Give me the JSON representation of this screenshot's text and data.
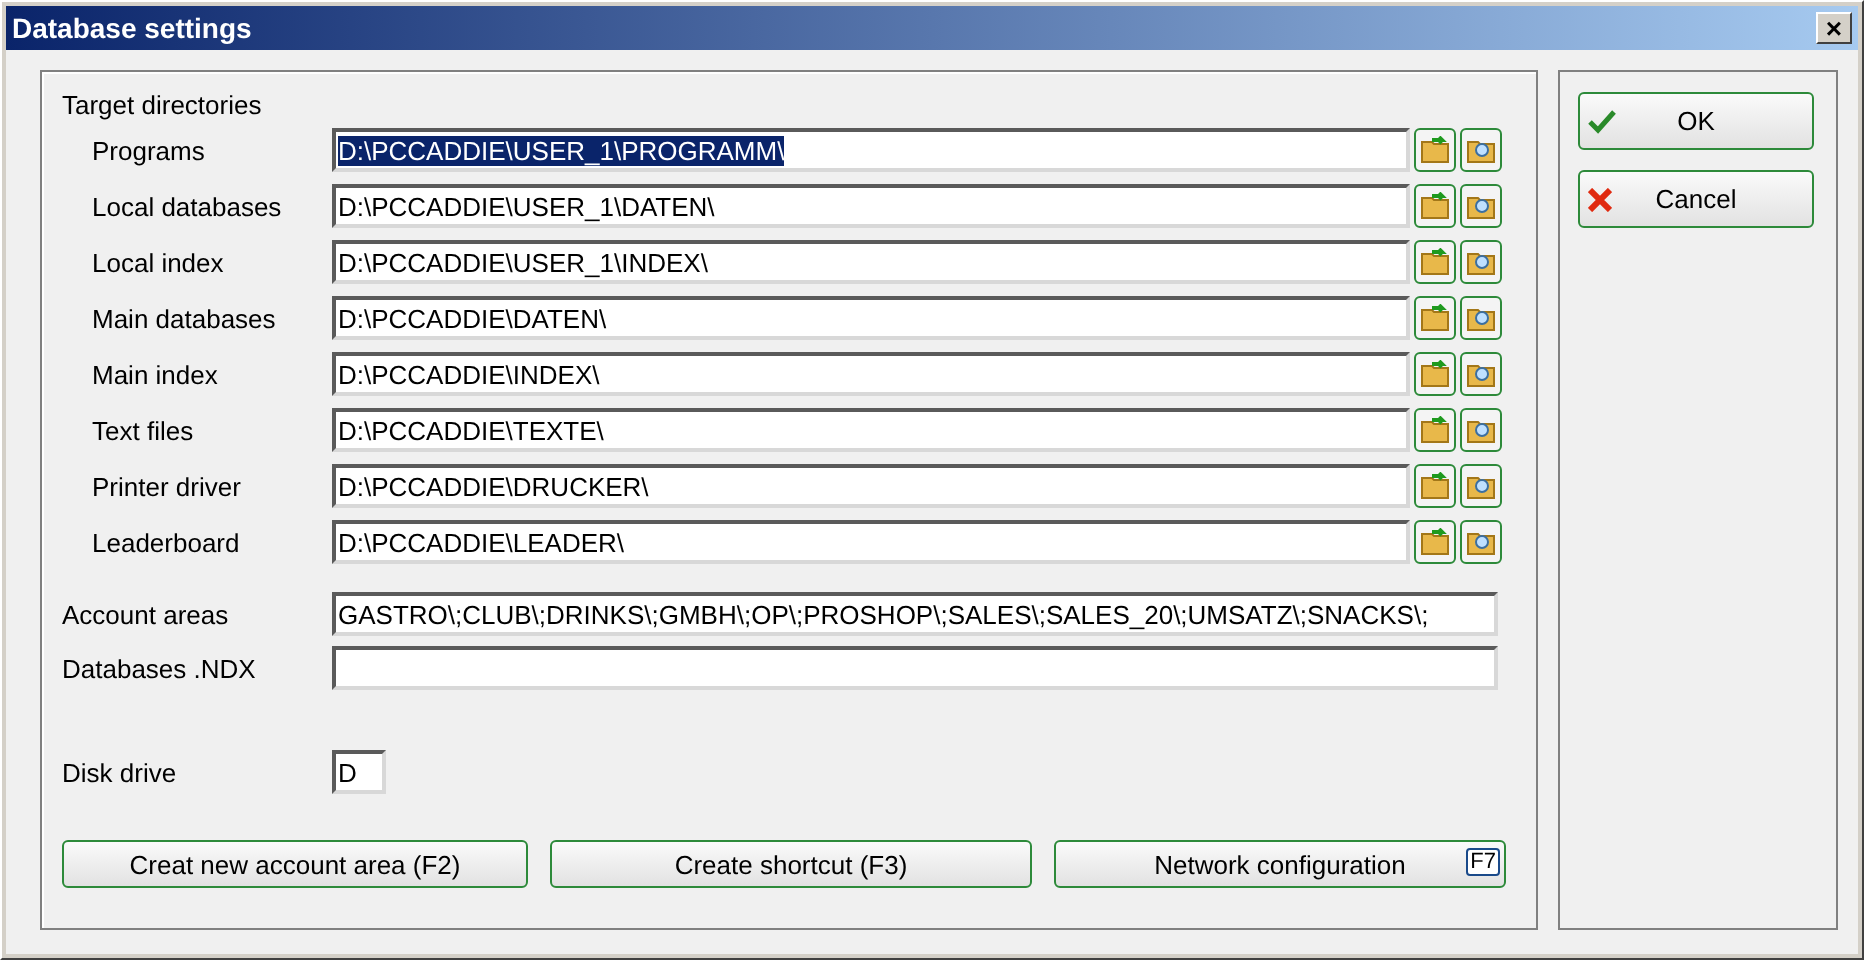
{
  "window": {
    "title": "Database settings",
    "close": "×"
  },
  "group_title": "Target directories",
  "directories": [
    {
      "label": "Programs",
      "value": "D:\\PCCADDIE\\USER_1\\PROGRAMM\\",
      "text_selected": true
    },
    {
      "label": "Local databases",
      "value": "D:\\PCCADDIE\\USER_1\\DATEN\\",
      "text_selected": false
    },
    {
      "label": "Local index",
      "value": "D:\\PCCADDIE\\USER_1\\INDEX\\",
      "text_selected": false
    },
    {
      "label": "Main databases",
      "value": "D:\\PCCADDIE\\DATEN\\",
      "text_selected": false
    },
    {
      "label": "Main index",
      "value": "D:\\PCCADDIE\\INDEX\\",
      "text_selected": false
    },
    {
      "label": "Text files",
      "value": "D:\\PCCADDIE\\TEXTE\\",
      "text_selected": false
    },
    {
      "label": "Printer driver",
      "value": "D:\\PCCADDIE\\DRUCKER\\",
      "text_selected": false
    },
    {
      "label": "Leaderboard",
      "value": "D:\\PCCADDIE\\LEADER\\",
      "text_selected": false
    }
  ],
  "account_areas": {
    "label": "Account areas",
    "value": "GASTRO\\;CLUB\\;DRINKS\\;GMBH\\;OP\\;PROSHOP\\;SALES\\;SALES_20\\;UMSATZ\\;SNACKS\\;"
  },
  "databases_ndx": {
    "label": "Databases .NDX"
  },
  "disk_drive": {
    "label": "Disk drive",
    "value": "D"
  },
  "buttons": [
    {
      "label": "Creat new account area (F2)"
    },
    {
      "label": "Create shortcut (F3)"
    },
    {
      "label": "Network configuration",
      "key": "F7"
    }
  ],
  "side_buttons": [
    {
      "label": "OK",
      "kind": "ok"
    },
    {
      "label": "Cancel",
      "kind": "cancel"
    }
  ]
}
